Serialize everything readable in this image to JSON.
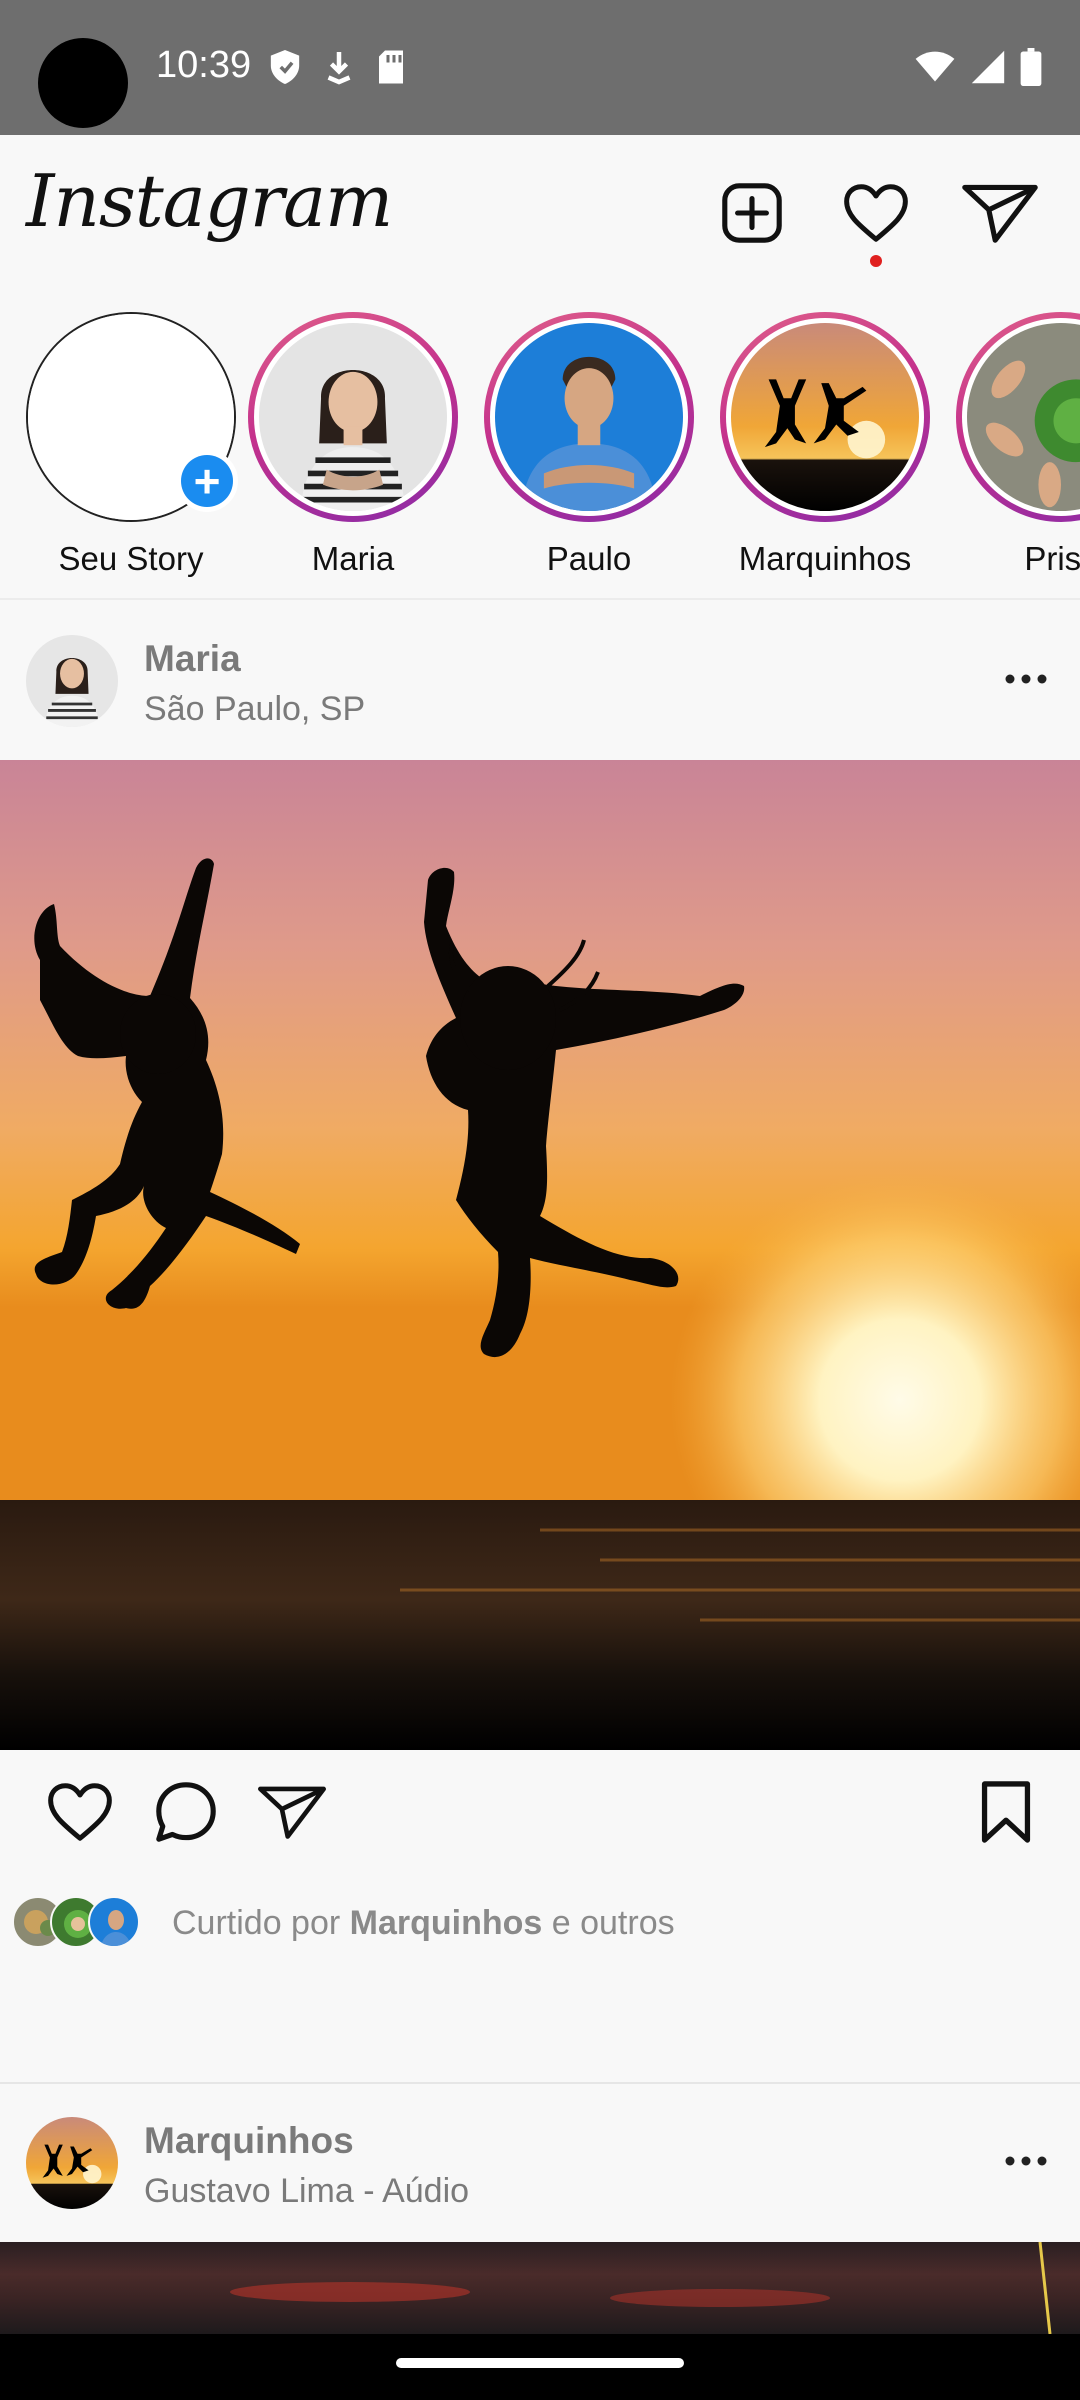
{
  "status_bar": {
    "time": "10:39",
    "icons": [
      "shield-icon",
      "download-icon",
      "sd-card-icon",
      "wifi-icon",
      "signal-icon",
      "battery-icon"
    ]
  },
  "app": {
    "logo": "Instagram",
    "actions": [
      "add-post-icon",
      "heart-icon",
      "send-icon"
    ],
    "notification_dot_color": "#e0201f"
  },
  "stories": [
    {
      "name": "Seu Story",
      "own": true
    },
    {
      "name": "Maria"
    },
    {
      "name": "Paulo"
    },
    {
      "name": "Marquinhos"
    },
    {
      "name": "Prisc"
    }
  ],
  "posts": [
    {
      "author": "Maria",
      "subtitle": "São Paulo, SP",
      "liked_by_prefix": "Curtido por ",
      "liked_by_name": "Marquinhos",
      "liked_by_suffix": " e outros"
    },
    {
      "author": "Marquinhos",
      "subtitle": "Gustavo Lima - Aúdio"
    }
  ],
  "colors": {
    "story_ring_start": "#e0608a",
    "story_ring_end": "#8a2aa8",
    "add_badge": "#1a8cf0"
  }
}
